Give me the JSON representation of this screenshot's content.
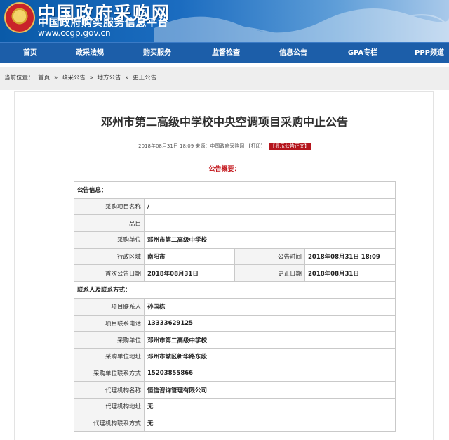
{
  "header": {
    "title": "中国政府采购网",
    "subtitle": "中国政府购买服务信息平台",
    "url": "www.ccgp.gov.cn"
  },
  "nav": {
    "items": [
      "首页",
      "政采法规",
      "购买服务",
      "监督检查",
      "信息公告",
      "GPA专栏",
      "PPP频道"
    ]
  },
  "breadcrumb": {
    "prefix": "当前位置：",
    "items": [
      "首页",
      "政采公告",
      "地方公告",
      "更正公告"
    ],
    "separator": "»"
  },
  "notice": {
    "title": "邓州市第二高级中学校中央空调项目采购中止公告",
    "meta": "2018年08月31日  18:09  来源：中国政府采购网 【打印】",
    "show_text_button": "【显示公告正文】",
    "summary_heading": "公告概要："
  },
  "info": {
    "section_label": "公告信息：",
    "project_name_label": "采购项目名称",
    "project_name": "/",
    "item_label": "品目",
    "item": "",
    "buyer_label": "采购单位",
    "buyer": "邓州市第二高级中学校",
    "region_label": "行政区域",
    "region": "南阳市",
    "publish_time_label": "公告时间",
    "publish_time": "2018年08月31日  18:09",
    "first_date_label": "首次公告日期",
    "first_date": "2018年08月31日",
    "correction_date_label": "更正日期",
    "correction_date": "2018年08月31日"
  },
  "contact": {
    "section_label": "联系人及联系方式：",
    "contact_person_label": "项目联系人",
    "contact_person": "孙国栋",
    "contact_phone_label": "项目联系电话",
    "contact_phone": "13333629125",
    "buyer_label": "采购单位",
    "buyer": "邓州市第二高级中学校",
    "buyer_address_label": "采购单位地址",
    "buyer_address": "邓州市城区新华路东段",
    "buyer_phone_label": "采购单位联系方式",
    "buyer_phone": "15203855866",
    "agency_label": "代理机构名称",
    "agency": "恒信咨询管理有限公司",
    "agency_address_label": "代理机构地址",
    "agency_address": "无",
    "agency_phone_label": "代理机构联系方式",
    "agency_phone": "无"
  },
  "colors": {
    "nav_blue": "#1c5ea9",
    "accent_red": "#c3161c"
  }
}
